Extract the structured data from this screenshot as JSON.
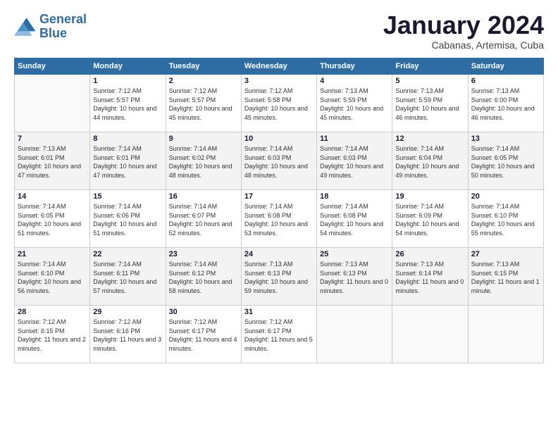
{
  "header": {
    "logo_line1": "General",
    "logo_line2": "Blue",
    "month_title": "January 2024",
    "subtitle": "Cabanas, Artemisa, Cuba"
  },
  "weekdays": [
    "Sunday",
    "Monday",
    "Tuesday",
    "Wednesday",
    "Thursday",
    "Friday",
    "Saturday"
  ],
  "weeks": [
    [
      {
        "num": "",
        "rise": "",
        "set": "",
        "daylight": ""
      },
      {
        "num": "1",
        "rise": "Sunrise: 7:12 AM",
        "set": "Sunset: 5:57 PM",
        "daylight": "Daylight: 10 hours and 44 minutes."
      },
      {
        "num": "2",
        "rise": "Sunrise: 7:12 AM",
        "set": "Sunset: 5:57 PM",
        "daylight": "Daylight: 10 hours and 45 minutes."
      },
      {
        "num": "3",
        "rise": "Sunrise: 7:12 AM",
        "set": "Sunset: 5:58 PM",
        "daylight": "Daylight: 10 hours and 45 minutes."
      },
      {
        "num": "4",
        "rise": "Sunrise: 7:13 AM",
        "set": "Sunset: 5:59 PM",
        "daylight": "Daylight: 10 hours and 45 minutes."
      },
      {
        "num": "5",
        "rise": "Sunrise: 7:13 AM",
        "set": "Sunset: 5:59 PM",
        "daylight": "Daylight: 10 hours and 46 minutes."
      },
      {
        "num": "6",
        "rise": "Sunrise: 7:13 AM",
        "set": "Sunset: 6:00 PM",
        "daylight": "Daylight: 10 hours and 46 minutes."
      }
    ],
    [
      {
        "num": "7",
        "rise": "Sunrise: 7:13 AM",
        "set": "Sunset: 6:01 PM",
        "daylight": "Daylight: 10 hours and 47 minutes."
      },
      {
        "num": "8",
        "rise": "Sunrise: 7:14 AM",
        "set": "Sunset: 6:01 PM",
        "daylight": "Daylight: 10 hours and 47 minutes."
      },
      {
        "num": "9",
        "rise": "Sunrise: 7:14 AM",
        "set": "Sunset: 6:02 PM",
        "daylight": "Daylight: 10 hours and 48 minutes."
      },
      {
        "num": "10",
        "rise": "Sunrise: 7:14 AM",
        "set": "Sunset: 6:03 PM",
        "daylight": "Daylight: 10 hours and 48 minutes."
      },
      {
        "num": "11",
        "rise": "Sunrise: 7:14 AM",
        "set": "Sunset: 6:03 PM",
        "daylight": "Daylight: 10 hours and 49 minutes."
      },
      {
        "num": "12",
        "rise": "Sunrise: 7:14 AM",
        "set": "Sunset: 6:04 PM",
        "daylight": "Daylight: 10 hours and 49 minutes."
      },
      {
        "num": "13",
        "rise": "Sunrise: 7:14 AM",
        "set": "Sunset: 6:05 PM",
        "daylight": "Daylight: 10 hours and 50 minutes."
      }
    ],
    [
      {
        "num": "14",
        "rise": "Sunrise: 7:14 AM",
        "set": "Sunset: 6:05 PM",
        "daylight": "Daylight: 10 hours and 51 minutes."
      },
      {
        "num": "15",
        "rise": "Sunrise: 7:14 AM",
        "set": "Sunset: 6:06 PM",
        "daylight": "Daylight: 10 hours and 51 minutes."
      },
      {
        "num": "16",
        "rise": "Sunrise: 7:14 AM",
        "set": "Sunset: 6:07 PM",
        "daylight": "Daylight: 10 hours and 52 minutes."
      },
      {
        "num": "17",
        "rise": "Sunrise: 7:14 AM",
        "set": "Sunset: 6:08 PM",
        "daylight": "Daylight: 10 hours and 53 minutes."
      },
      {
        "num": "18",
        "rise": "Sunrise: 7:14 AM",
        "set": "Sunset: 6:08 PM",
        "daylight": "Daylight: 10 hours and 54 minutes."
      },
      {
        "num": "19",
        "rise": "Sunrise: 7:14 AM",
        "set": "Sunset: 6:09 PM",
        "daylight": "Daylight: 10 hours and 54 minutes."
      },
      {
        "num": "20",
        "rise": "Sunrise: 7:14 AM",
        "set": "Sunset: 6:10 PM",
        "daylight": "Daylight: 10 hours and 55 minutes."
      }
    ],
    [
      {
        "num": "21",
        "rise": "Sunrise: 7:14 AM",
        "set": "Sunset: 6:10 PM",
        "daylight": "Daylight: 10 hours and 56 minutes."
      },
      {
        "num": "22",
        "rise": "Sunrise: 7:14 AM",
        "set": "Sunset: 6:11 PM",
        "daylight": "Daylight: 10 hours and 57 minutes."
      },
      {
        "num": "23",
        "rise": "Sunrise: 7:14 AM",
        "set": "Sunset: 6:12 PM",
        "daylight": "Daylight: 10 hours and 58 minutes."
      },
      {
        "num": "24",
        "rise": "Sunrise: 7:13 AM",
        "set": "Sunset: 6:13 PM",
        "daylight": "Daylight: 10 hours and 59 minutes."
      },
      {
        "num": "25",
        "rise": "Sunrise: 7:13 AM",
        "set": "Sunset: 6:13 PM",
        "daylight": "Daylight: 11 hours and 0 minutes."
      },
      {
        "num": "26",
        "rise": "Sunrise: 7:13 AM",
        "set": "Sunset: 6:14 PM",
        "daylight": "Daylight: 11 hours and 0 minutes."
      },
      {
        "num": "27",
        "rise": "Sunrise: 7:13 AM",
        "set": "Sunset: 6:15 PM",
        "daylight": "Daylight: 11 hours and 1 minute."
      }
    ],
    [
      {
        "num": "28",
        "rise": "Sunrise: 7:12 AM",
        "set": "Sunset: 6:15 PM",
        "daylight": "Daylight: 11 hours and 2 minutes."
      },
      {
        "num": "29",
        "rise": "Sunrise: 7:12 AM",
        "set": "Sunset: 6:16 PM",
        "daylight": "Daylight: 11 hours and 3 minutes."
      },
      {
        "num": "30",
        "rise": "Sunrise: 7:12 AM",
        "set": "Sunset: 6:17 PM",
        "daylight": "Daylight: 11 hours and 4 minutes."
      },
      {
        "num": "31",
        "rise": "Sunrise: 7:12 AM",
        "set": "Sunset: 6:17 PM",
        "daylight": "Daylight: 11 hours and 5 minutes."
      },
      {
        "num": "",
        "rise": "",
        "set": "",
        "daylight": ""
      },
      {
        "num": "",
        "rise": "",
        "set": "",
        "daylight": ""
      },
      {
        "num": "",
        "rise": "",
        "set": "",
        "daylight": ""
      }
    ]
  ]
}
